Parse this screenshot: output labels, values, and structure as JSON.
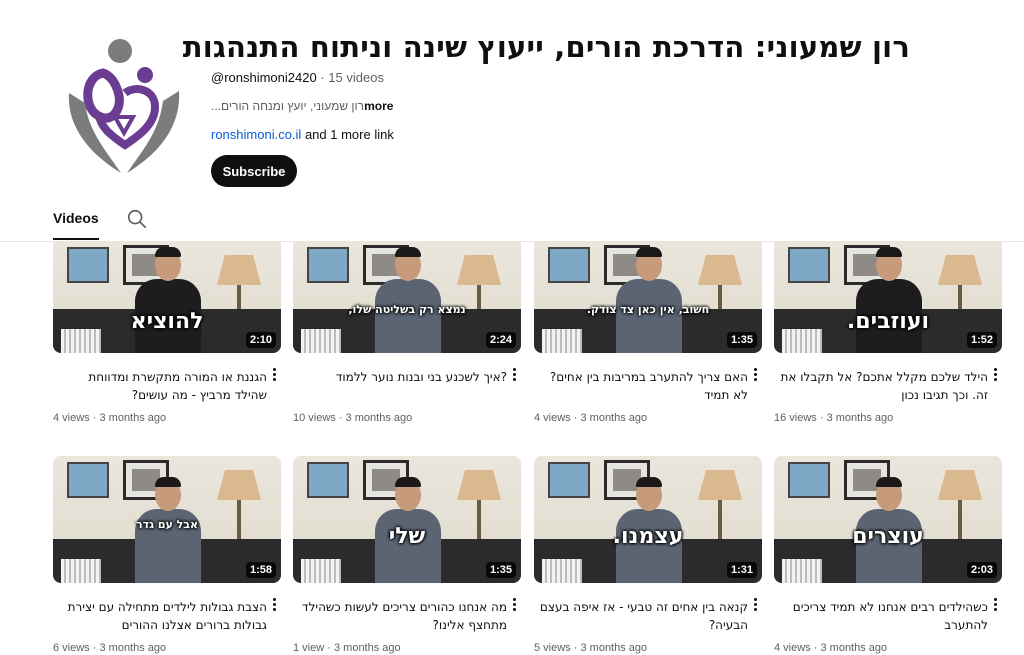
{
  "channel": {
    "title": "רון שמעוני: הדרכת הורים, ייעוץ שינה וניתוח התנהגות",
    "handle": "@ronshimoni2420",
    "separator": "·",
    "video_count": "15 videos",
    "description": "...רון שמעוני, יועץ ומנחה הורים",
    "more_label": "more",
    "link": "ronshimoni.co.il",
    "more_links": "and 1 more link",
    "subscribe_label": "Subscribe",
    "avatar_icon": "parent-hands-logo-icon",
    "accent_purple": "#6a3d93",
    "accent_gray": "#7c7c7c"
  },
  "tabs": {
    "videos_label": "Videos",
    "search_icon": "search-icon"
  },
  "videos": [
    {
      "overlay": "להוציא",
      "overlay_style": "big",
      "shirt": "dark",
      "duration": "2:10",
      "title": "הגננת או המורה מתקשרת ומדווחת שהילד מרביץ - מה עושים?",
      "views": "4 views",
      "age": "3 months ago"
    },
    {
      "overlay": "נמצא רק בשליטה שלו,",
      "overlay_style": "small",
      "shirt": "gray",
      "duration": "2:24",
      "title": "?איך לשכנע בני ובנות נוער ללמוד",
      "views": "10 views",
      "age": "3 months ago"
    },
    {
      "overlay": "חשוב, אין כאן צד צודק.",
      "overlay_style": "small",
      "shirt": "gray",
      "duration": "1:35",
      "title": "האם צריך להתערב במריבות בין אחים? לא תמיד",
      "views": "4 views",
      "age": "3 months ago"
    },
    {
      "overlay": "ועוזבים.",
      "overlay_style": "big",
      "shirt": "dark",
      "duration": "1:52",
      "title": "הילד שלכם מקלל אתכם? אל תקבלו את זה. וכך תגיבו נכון",
      "views": "16 views",
      "age": "3 months ago"
    },
    {
      "overlay": "אבל עם גדר",
      "overlay_style": "small",
      "shirt": "gray",
      "duration": "1:58",
      "title": "הצבת גבולות לילדים מתחילה עם יצירת גבולות ברורים אצלנו ההורים",
      "views": "6 views",
      "age": "3 months ago"
    },
    {
      "overlay": "שלי",
      "overlay_style": "big",
      "shirt": "gray",
      "duration": "1:35",
      "title": "מה אנחנו כהורים צריכים לעשות כשהילד מתחצף אלינו?",
      "views": "1 view",
      "age": "3 months ago"
    },
    {
      "overlay": "עצמנו.",
      "overlay_style": "big",
      "shirt": "gray",
      "duration": "1:31",
      "title": "קנאה בין אחים זה טבעי - אז איפה בעצם הבעיה?",
      "views": "5 views",
      "age": "3 months ago"
    },
    {
      "overlay": "עוצרים",
      "overlay_style": "big",
      "shirt": "gray",
      "duration": "2:03",
      "title": "כשהילדים רבים אנחנו לא תמיד צריכים להתערב",
      "views": "4 views",
      "age": "3 months ago"
    }
  ]
}
